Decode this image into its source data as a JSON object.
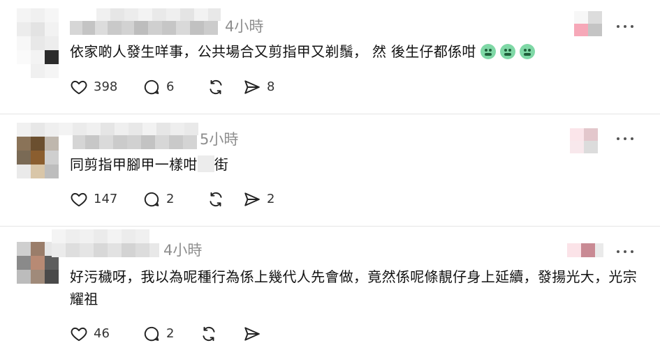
{
  "colors": {
    "timestamp": "#8e8e8e",
    "divider": "#e5e5e5",
    "text": "#111111"
  },
  "comments": [
    {
      "timestamp": "4小時",
      "text": "依家啲人發生咩事，公共場合又剪指甲又剃鬚， 然 後生仔都係咁",
      "emojis": [
        "nauseated-face",
        "nauseated-face",
        "nauseated-face"
      ],
      "likes": "398",
      "replies": "6",
      "reposts": "",
      "shares": "8"
    },
    {
      "timestamp": "5小時",
      "text_before": "同剪指甲腳甲一樣咁",
      "text_after": "街",
      "likes": "147",
      "replies": "2",
      "reposts": "",
      "shares": "2"
    },
    {
      "timestamp": "4小時",
      "text": "好污穢呀，我以為呢種行為係上幾代人先會做，竟然係呢條靚仔身上延續，發揚光大，光宗耀祖",
      "likes": "46",
      "replies": "2",
      "reposts": "",
      "shares": ""
    }
  ],
  "icons": {
    "like": "heart-icon",
    "reply": "speech-bubble-icon",
    "repost": "repost-arrows-icon",
    "share": "paper-plane-icon",
    "more": "more-options-icon"
  }
}
